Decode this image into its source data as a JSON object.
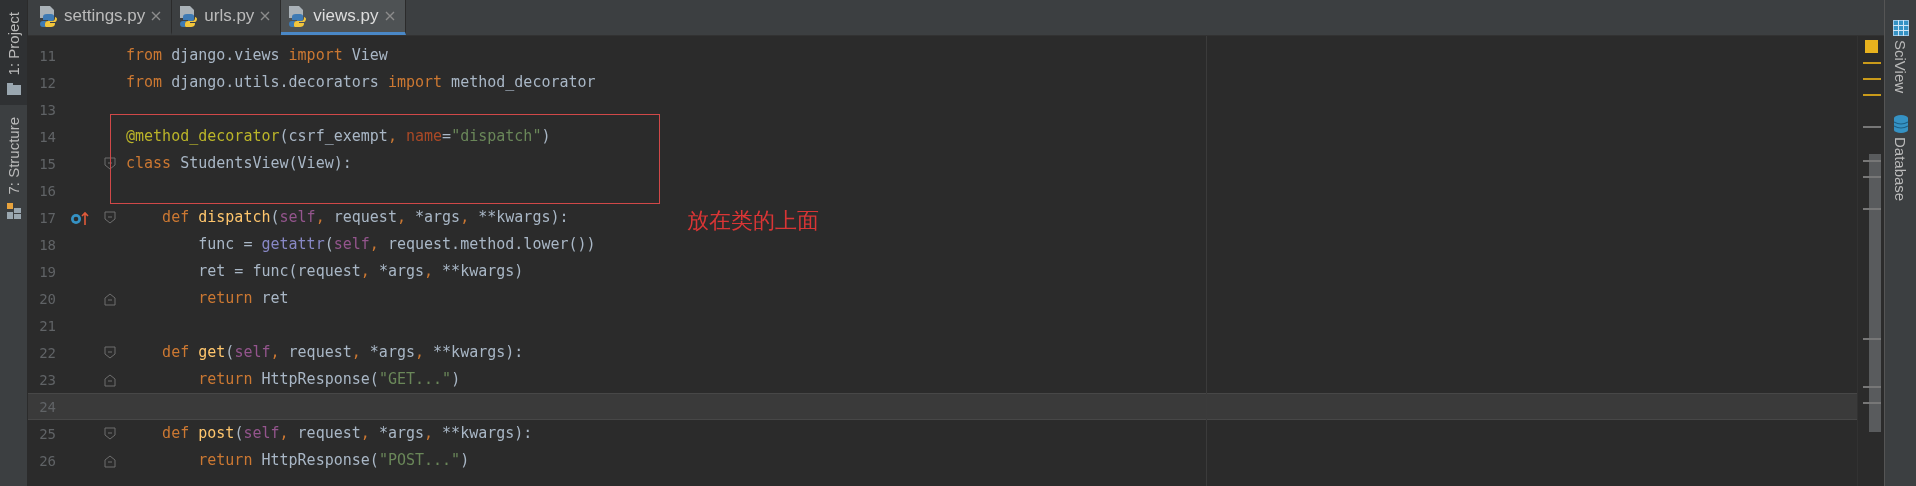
{
  "left_toolbar": [
    {
      "label": "1: Project",
      "kind": "project"
    },
    {
      "label": "7: Structure",
      "kind": "structure"
    }
  ],
  "tabs": [
    {
      "label": "settings.py",
      "selected": false
    },
    {
      "label": "urls.py",
      "selected": false
    },
    {
      "label": "views.py",
      "selected": true
    }
  ],
  "editor": {
    "lines": [
      {
        "number": "11",
        "current": false,
        "tokens": [
          {
            "kind": "keyword",
            "text": "from"
          },
          {
            "kind": "plain",
            "text": " django.views "
          },
          {
            "kind": "keyword",
            "text": "import"
          },
          {
            "kind": "plain",
            "text": " View"
          }
        ]
      },
      {
        "number": "12",
        "current": false,
        "tokens": [
          {
            "kind": "keyword",
            "text": "from"
          },
          {
            "kind": "plain",
            "text": " django.utils.decorators "
          },
          {
            "kind": "keyword",
            "text": "import"
          },
          {
            "kind": "plain",
            "text": " method_decorator"
          }
        ]
      },
      {
        "number": "13",
        "current": false
      },
      {
        "number": "14",
        "current": false,
        "tokens": [
          {
            "kind": "decorator",
            "text": "@method_decorator"
          },
          {
            "kind": "plain",
            "text": "(csrf_exempt"
          },
          {
            "kind": "keyword",
            "text": ", "
          },
          {
            "kind": "param",
            "text": "name"
          },
          {
            "kind": "plain",
            "text": "="
          },
          {
            "kind": "string",
            "text": "\"dispatch\""
          },
          {
            "kind": "plain",
            "text": ")"
          }
        ]
      },
      {
        "number": "15",
        "current": false,
        "gutter": [
          {
            "kind": "fold_open"
          }
        ],
        "tokens": [
          {
            "kind": "keyword",
            "text": "class"
          },
          {
            "kind": "plain",
            "text": " StudentsView(View):"
          }
        ]
      },
      {
        "number": "16",
        "current": false
      },
      {
        "number": "17",
        "current": false,
        "gutter": [
          {
            "kind": "override"
          },
          {
            "kind": "fold_open"
          }
        ],
        "tokens": [
          {
            "kind": "keyword",
            "text": "    def"
          },
          {
            "kind": "function",
            "text": " dispatch"
          },
          {
            "kind": "plain",
            "text": "("
          },
          {
            "kind": "self",
            "text": "self"
          },
          {
            "kind": "keyword",
            "text": ", "
          },
          {
            "kind": "plain",
            "text": "request"
          },
          {
            "kind": "keyword",
            "text": ", "
          },
          {
            "kind": "plain",
            "text": "*args"
          },
          {
            "kind": "keyword",
            "text": ", "
          },
          {
            "kind": "plain",
            "text": "**kwargs):"
          }
        ]
      },
      {
        "number": "18",
        "current": false,
        "tokens": [
          {
            "kind": "plain",
            "text": "        func = "
          },
          {
            "kind": "builtin",
            "text": "getattr"
          },
          {
            "kind": "plain",
            "text": "("
          },
          {
            "kind": "self",
            "text": "self"
          },
          {
            "kind": "keyword",
            "text": ", "
          },
          {
            "kind": "plain",
            "text": "request.method.lower())"
          }
        ]
      },
      {
        "number": "19",
        "current": false,
        "tokens": [
          {
            "kind": "plain",
            "text": "        ret = func(request"
          },
          {
            "kind": "keyword",
            "text": ", "
          },
          {
            "kind": "plain",
            "text": "*args"
          },
          {
            "kind": "keyword",
            "text": ", "
          },
          {
            "kind": "plain",
            "text": "**kwargs)"
          }
        ]
      },
      {
        "number": "20",
        "current": false,
        "gutter": [
          {
            "kind": "fold_close"
          }
        ],
        "tokens": [
          {
            "kind": "keyword",
            "text": "        return"
          },
          {
            "kind": "plain",
            "text": " ret"
          }
        ]
      },
      {
        "number": "21",
        "current": false
      },
      {
        "number": "22",
        "current": false,
        "gutter": [
          {
            "kind": "fold_open"
          }
        ],
        "tokens": [
          {
            "kind": "keyword",
            "text": "    def"
          },
          {
            "kind": "function",
            "text": " get"
          },
          {
            "kind": "plain",
            "text": "("
          },
          {
            "kind": "self",
            "text": "self"
          },
          {
            "kind": "keyword",
            "text": ", "
          },
          {
            "kind": "plain",
            "text": "request"
          },
          {
            "kind": "keyword",
            "text": ", "
          },
          {
            "kind": "plain",
            "text": "*args"
          },
          {
            "kind": "keyword",
            "text": ", "
          },
          {
            "kind": "plain",
            "text": "**kwargs):"
          }
        ]
      },
      {
        "number": "23",
        "current": false,
        "gutter": [
          {
            "kind": "fold_close"
          }
        ],
        "tokens": [
          {
            "kind": "keyword",
            "text": "        return"
          },
          {
            "kind": "plain",
            "text": " HttpResponse("
          },
          {
            "kind": "string",
            "text": "\"GET...\""
          },
          {
            "kind": "plain",
            "text": ")"
          }
        ]
      },
      {
        "number": "24",
        "current": true
      },
      {
        "number": "25",
        "current": false,
        "gutter": [
          {
            "kind": "fold_open"
          }
        ],
        "tokens": [
          {
            "kind": "keyword",
            "text": "    def"
          },
          {
            "kind": "function",
            "text": " post"
          },
          {
            "kind": "plain",
            "text": "("
          },
          {
            "kind": "self",
            "text": "self"
          },
          {
            "kind": "keyword",
            "text": ", "
          },
          {
            "kind": "plain",
            "text": "request"
          },
          {
            "kind": "keyword",
            "text": ", "
          },
          {
            "kind": "plain",
            "text": "*args"
          },
          {
            "kind": "keyword",
            "text": ", "
          },
          {
            "kind": "plain",
            "text": "**kwargs):"
          }
        ]
      },
      {
        "number": "26",
        "current": false,
        "gutter": [
          {
            "kind": "fold_close"
          }
        ],
        "tokens": [
          {
            "kind": "keyword",
            "text": "        return"
          },
          {
            "kind": "plain",
            "text": " HttpResponse("
          },
          {
            "kind": "string",
            "text": "\"POST...\""
          },
          {
            "kind": "plain",
            "text": ")"
          }
        ]
      }
    ]
  },
  "annotation": {
    "text": "放在类的上面"
  },
  "right_toolbar": [
    {
      "label": "SciView",
      "kind": "sciview"
    },
    {
      "label": "Database",
      "kind": "database"
    }
  ]
}
